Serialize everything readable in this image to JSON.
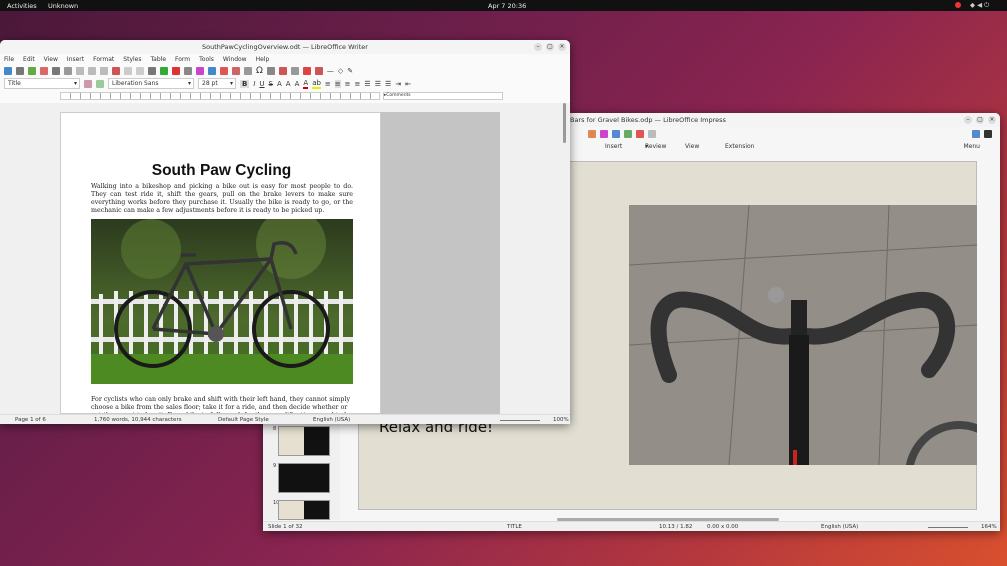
{
  "topbar": {
    "activities": "Activities",
    "app": "Unknown",
    "clock": "Apr 7  20:36"
  },
  "writer": {
    "title": "SouthPawCyclingOverview.odt — LibreOffice Writer",
    "menu": [
      "File",
      "Edit",
      "View",
      "Insert",
      "Format",
      "Styles",
      "Table",
      "Form",
      "Tools",
      "Window",
      "Help"
    ],
    "paragraph_style": "Title",
    "font_name": "Liberation Sans",
    "font_size": "28 pt",
    "ruler_comments": "▸Comments",
    "doc": {
      "heading": "South Paw Cycling",
      "para1": "Walking into a bikeshop and picking a bike out is easy for most people to do. They can test ride it, shift the gears, pull on the brake levers to make sure everything works before they purchase it. Usually the bike is ready to go, or the mechanic can make a few adjustments before it is ready to be picked up.",
      "para2": "For cyclists who can only brake and shift with their left hand, they cannot simply choose a bike from the sales floor; take it for a ride, and then decide whether or not they want to buy it. For a bike to fully work for them modifications need to be made. This may as"
    },
    "status": {
      "page": "Page 1 of 6",
      "words": "1,760 words, 10,944 characters",
      "page_style": "Default Page Style",
      "language": "English (USA)",
      "zoom": "100%"
    }
  },
  "impress": {
    "title": "Bars for Gravel Bikes.odp — LibreOffice Impress",
    "tabs": [
      "Insert",
      "Review",
      "View",
      "Extension"
    ],
    "menu_label": "Menu",
    "slide_text": "Relax and ride!",
    "thumbnails": [
      "8",
      "9",
      "10"
    ],
    "status": {
      "slide": "Slide 1 of 32",
      "layout": "TITLE",
      "position": "10.13 / 1.82",
      "size": "0.00 x 0.00",
      "language": "English (USA)",
      "zoom": "164%"
    }
  }
}
